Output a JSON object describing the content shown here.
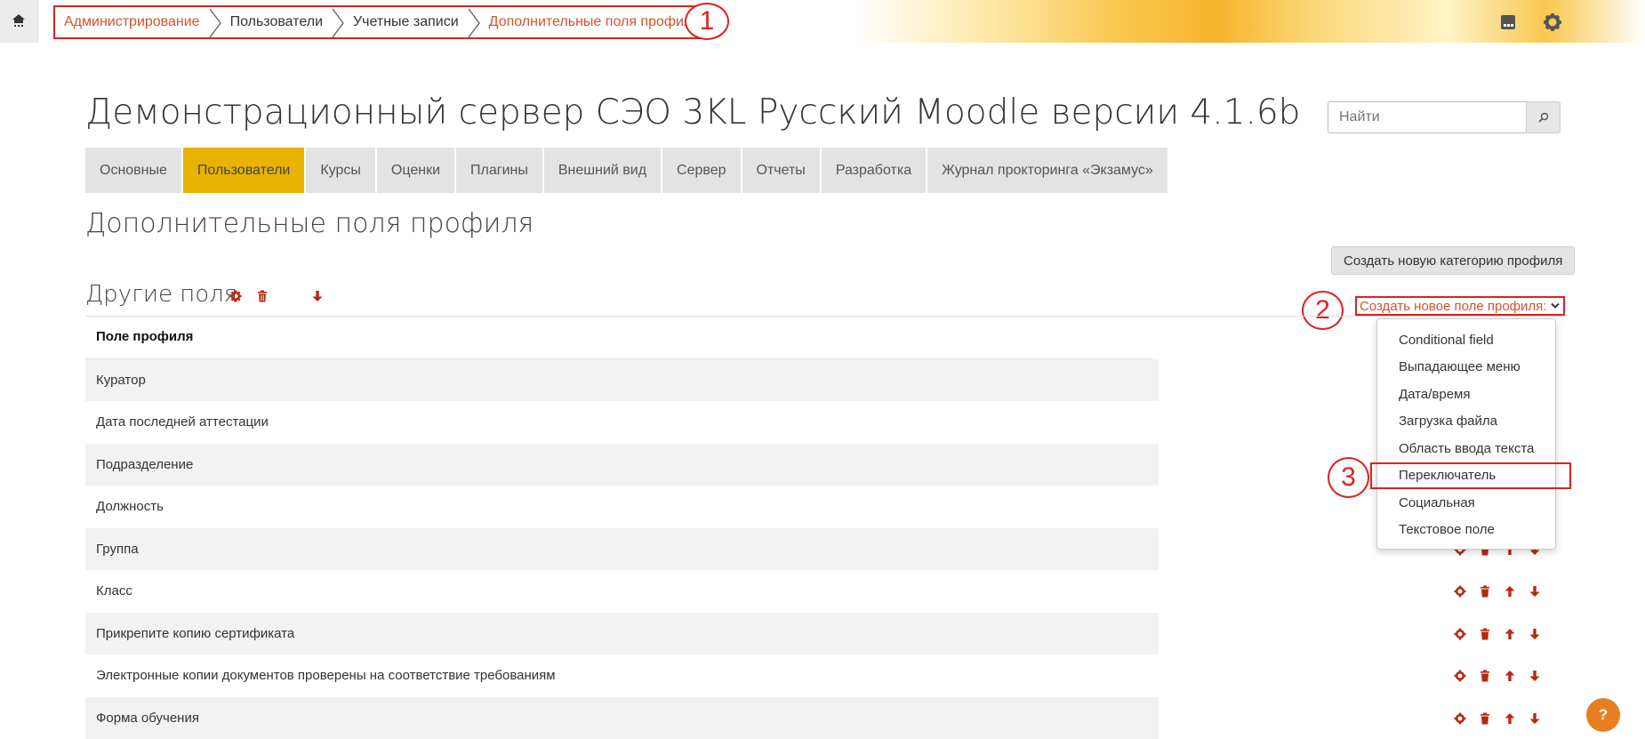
{
  "breadcrumb": [
    {
      "label": "Администрирование",
      "link": true
    },
    {
      "label": "Пользователи",
      "link": false
    },
    {
      "label": "Учетные записи",
      "link": false
    },
    {
      "label": "Дополнительные поля профиля",
      "link": true
    }
  ],
  "markers": {
    "one": "1",
    "two": "2",
    "three": "3"
  },
  "site_title": "Демонстрационный сервер СЭО 3KL Русский Moodle версии 4.1.6b",
  "search": {
    "placeholder": "Найти"
  },
  "tabs": [
    "Основные",
    "Пользователи",
    "Курсы",
    "Оценки",
    "Плагины",
    "Внешний вид",
    "Сервер",
    "Отчеты",
    "Разработка",
    "Журнал прокторинга «Экзамус»"
  ],
  "active_tab": "Пользователи",
  "page_heading": "Дополнительные поля профиля",
  "new_category_button": "Создать новую категорию профиля",
  "category": {
    "name": "Другие поля"
  },
  "create_field_label": "Создать новое поле профиля:",
  "table_header": "Поле профиля",
  "fields": [
    "Куратор",
    "Дата последней аттестации",
    "Подразделение",
    "Должность",
    "Группа",
    "Класс",
    "Прикрепите копию сертификата",
    "Электронные копии документов проверены на соответствие требованиям",
    "Форма обучения"
  ],
  "dropdown_options": [
    "Conditional field",
    "Выпадающее меню",
    "Дата/время",
    "Загрузка файла",
    "Область ввода текста",
    "Переключатель",
    "Социальная",
    "Текстовое поле"
  ],
  "highlighted_option": "Переключатель",
  "help": "?",
  "colors": {
    "accent": "#d3542a",
    "active_tab": "#e8b200",
    "action_icon": "#b52a10",
    "annotation": "#e02020"
  }
}
